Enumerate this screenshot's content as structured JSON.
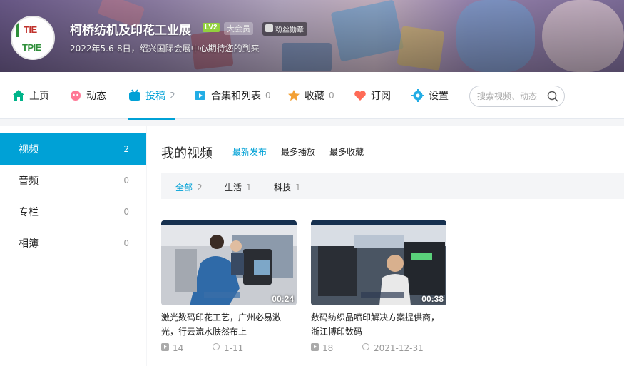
{
  "profile": {
    "name": "柯桥纺机及印花工业展",
    "level": "LV2",
    "vip": "大会员",
    "fan_badge": "粉丝勋章",
    "sign": "2022年5.6-8日，绍兴国际会展中心期待您的到来",
    "avatar_text": [
      "TIE",
      "TPIE"
    ]
  },
  "nav": {
    "items": [
      {
        "label": "主页",
        "count": "",
        "icon": "home-icon"
      },
      {
        "label": "动态",
        "count": "",
        "icon": "dynamic-icon"
      },
      {
        "label": "投稿",
        "count": "2",
        "icon": "contribute-icon"
      },
      {
        "label": "合集和列表",
        "count": "0",
        "icon": "collection-icon"
      },
      {
        "label": "收藏",
        "count": "0",
        "icon": "favorite-icon"
      },
      {
        "label": "订阅",
        "count": "",
        "icon": "subscribe-icon"
      },
      {
        "label": "设置",
        "count": "",
        "icon": "settings-icon"
      }
    ],
    "search_placeholder": "搜索视频、动态"
  },
  "sidebar": {
    "items": [
      {
        "label": "视频",
        "count": "2"
      },
      {
        "label": "音频",
        "count": "0"
      },
      {
        "label": "专栏",
        "count": "0"
      },
      {
        "label": "相簿",
        "count": "0"
      }
    ]
  },
  "main": {
    "title": "我的视频",
    "sort_tabs": [
      "最新发布",
      "最多播放",
      "最多收藏"
    ],
    "filters": [
      {
        "label": "全部",
        "count": "2"
      },
      {
        "label": "生活",
        "count": "1"
      },
      {
        "label": "科技",
        "count": "1"
      }
    ],
    "videos": [
      {
        "title": "激光数码印花工艺，广州必易激光，行云流水肤然布上",
        "duration": "00:24",
        "plays": "14",
        "date": "1-11"
      },
      {
        "title": "数码纺织品喷印解决方案提供商，浙江博印数码",
        "duration": "00:38",
        "plays": "18",
        "date": "2021-12-31"
      }
    ]
  },
  "colors": {
    "accent": "#00a1d6",
    "level_badge": "#93d13d"
  }
}
